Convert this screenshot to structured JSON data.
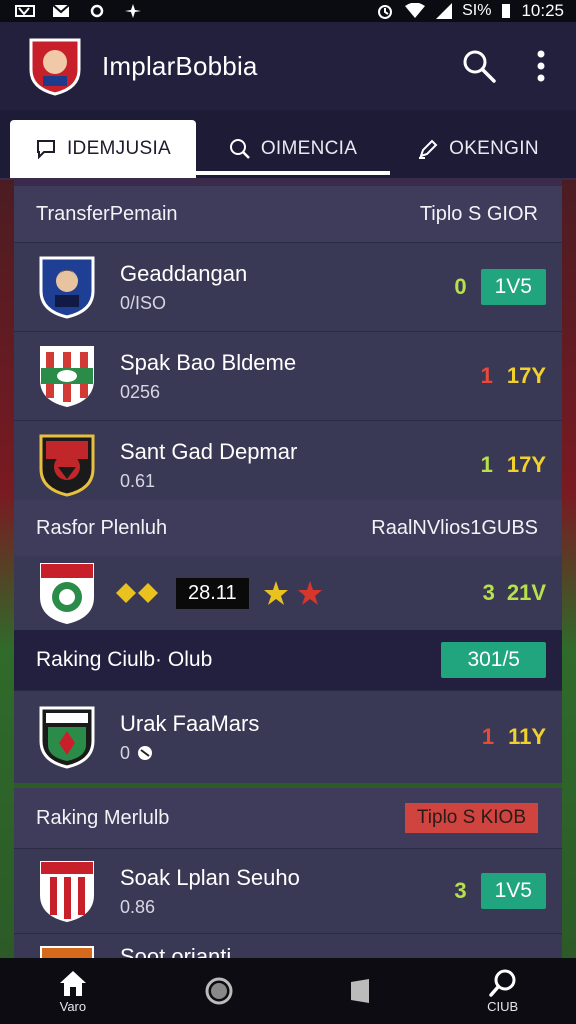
{
  "status_bar": {
    "battery": "SI%",
    "time": "10:25"
  },
  "app": {
    "title": "ImplarBobbia"
  },
  "tabs": [
    {
      "label": "IDEMJUSIA"
    },
    {
      "label": "OIMENCIA"
    },
    {
      "label": "OKENGIN"
    }
  ],
  "section1": {
    "title": "TransferPemain",
    "right": "Tiplo S GIOR",
    "rows": [
      {
        "name": "Geaddangan",
        "sub": "0/ISO",
        "score": "0",
        "badge": "1V5"
      },
      {
        "name": "Spak Bao Bldeme",
        "sub": "0256",
        "score": "1",
        "value": "17Y"
      },
      {
        "name": "Sant Gad Depmar",
        "sub": "0.61",
        "score": "1",
        "value": "17Y"
      }
    ]
  },
  "section2": {
    "title": "Rasfor Plenluh",
    "right": "RaalNVlios1GUBS",
    "feature": {
      "rating": "28.11",
      "score": "3",
      "value": "21V"
    }
  },
  "section3": {
    "title": "Raking Ciulb· Olub",
    "badge": "301/5",
    "row": {
      "name": "Urak FaaMars",
      "sub": "0",
      "score": "1",
      "value": "11Y"
    }
  },
  "section4": {
    "title": "Raking Merlulb",
    "badge": "Tiplo S KIOB",
    "row": {
      "name": "Soak Lplan Seuho",
      "sub": "0.86",
      "score": "3",
      "badge": "1V5"
    },
    "partial_row": {
      "name": "Soot orianti"
    }
  },
  "bottom_nav": [
    {
      "label": "Varo",
      "icon": "home-icon"
    },
    {
      "label": "",
      "icon": "circle-icon"
    },
    {
      "label": "",
      "icon": "square-icon"
    },
    {
      "label": "CIUB",
      "icon": "search-icon"
    }
  ],
  "colors": {
    "appbar": "#23203e",
    "row_bg": "#3a3955",
    "accent_green": "#21a57e",
    "accent_red": "#d0443f"
  }
}
